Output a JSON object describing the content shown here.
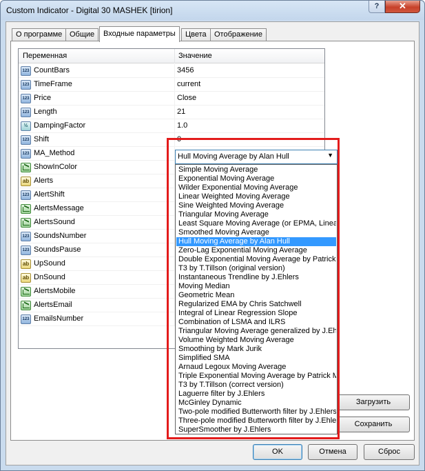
{
  "window": {
    "title": "Custom Indicator - Digital 30 MASHEK [tirion]",
    "help_label": "?",
    "close_label": "✕"
  },
  "tabs": [
    "О программе",
    "Общие",
    "Входные параметры",
    "Цвета",
    "Отображение"
  ],
  "active_tab": 2,
  "grid": {
    "col_variable": "Переменная",
    "col_value": "Значение",
    "rows": [
      {
        "name": "CountBars",
        "value": "3456",
        "type_icon": "123"
      },
      {
        "name": "TimeFrame",
        "value": "current",
        "type_icon": "123"
      },
      {
        "name": "Price",
        "value": "Close",
        "type_icon": "123"
      },
      {
        "name": "Length",
        "value": "21",
        "type_icon": "123"
      },
      {
        "name": "DampingFactor",
        "value": "1.0",
        "type_icon": "½"
      },
      {
        "name": "Shift",
        "value": "0",
        "type_icon": "123"
      },
      {
        "name": "MA_Method",
        "value": "",
        "type_icon": "123"
      },
      {
        "name": "ShowInColor",
        "value": "",
        "type_icon": ""
      },
      {
        "name": "Alerts",
        "value": "",
        "type_icon": "ab"
      },
      {
        "name": "AlertShift",
        "value": "",
        "type_icon": "123"
      },
      {
        "name": "AlertsMessage",
        "value": "",
        "type_icon": ""
      },
      {
        "name": "AlertsSound",
        "value": "",
        "type_icon": ""
      },
      {
        "name": "SoundsNumber",
        "value": "",
        "type_icon": "123"
      },
      {
        "name": "SoundsPause",
        "value": "",
        "type_icon": "123"
      },
      {
        "name": "UpSound",
        "value": "",
        "type_icon": "ab"
      },
      {
        "name": "DnSound",
        "value": "",
        "type_icon": "ab"
      },
      {
        "name": "AlertsMobile",
        "value": "",
        "type_icon": ""
      },
      {
        "name": "AlertsEmail",
        "value": "",
        "type_icon": ""
      },
      {
        "name": "EmailsNumber",
        "value": "",
        "type_icon": "123"
      }
    ]
  },
  "ma_method": {
    "selected": "Hull Moving Average by Alan Hull",
    "options": [
      "Simple Moving Average",
      "Exponential Moving Average",
      "Wilder Exponential Moving Average",
      "Linear Weighted Moving Average",
      "Sine Weighted Moving Average",
      "Triangular Moving Average",
      "Least Square Moving Average (or EPMA, Linea",
      "Smoothed Moving Average",
      "Hull Moving Average by Alan Hull",
      "Zero-Lag Exponential Moving Average",
      "Double Exponential Moving Average by Patrick",
      "T3 by T.Tillson (original version)",
      "Instantaneous Trendline by J.Ehlers",
      "Moving Median",
      "Geometric Mean",
      "Regularized EMA by Chris Satchwell",
      "Integral of Linear Regression Slope",
      "Combination of LSMA and ILRS",
      "Triangular Moving Average generalized by J.Ehl",
      "Volume Weighted Moving Average",
      "Smoothing by Mark Jurik",
      "Simplified SMA",
      "Arnaud Legoux Moving Average",
      "Triple Exponential Moving Average by Patrick M",
      "T3 by T.Tillson (correct version)",
      "Laguerre filter by J.Ehlers",
      "McGinley Dynamic",
      "Two-pole modified Butterworth filter by J.Ehlers",
      "Three-pole modified Butterworth filter by J.Ehlers",
      "SuperSmoother by J.Ehlers"
    ],
    "selected_index": 8
  },
  "side_buttons": {
    "load": "Загрузить",
    "save": "Сохранить"
  },
  "footer": {
    "ok": "OK",
    "cancel": "Отмена",
    "reset": "Сброс"
  },
  "colors": {
    "highlight": "#e31b1b",
    "selection": "#3399ff"
  }
}
